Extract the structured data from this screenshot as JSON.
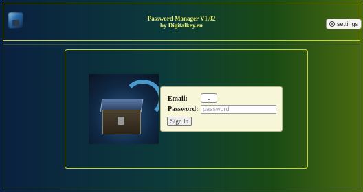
{
  "header": {
    "logo_icon": "vault-logo-icon",
    "title_line1": "Password Manager V1.02",
    "title_line2": "by Digitalkey.eu",
    "settings_label": "settings",
    "settings_icon": "gear-icon"
  },
  "hero": {
    "image": "open-chest-data-illustration"
  },
  "login": {
    "email_label": "Email:",
    "email_selected": "",
    "email_dropdown_icon": "chevron-down-icon",
    "password_label": "Password:",
    "password_placeholder": "password",
    "signin_label": "Sign In"
  },
  "colors": {
    "accent_yellow": "#c9d432",
    "title_text": "#e8f070",
    "form_bg": "#f7f6d8"
  }
}
